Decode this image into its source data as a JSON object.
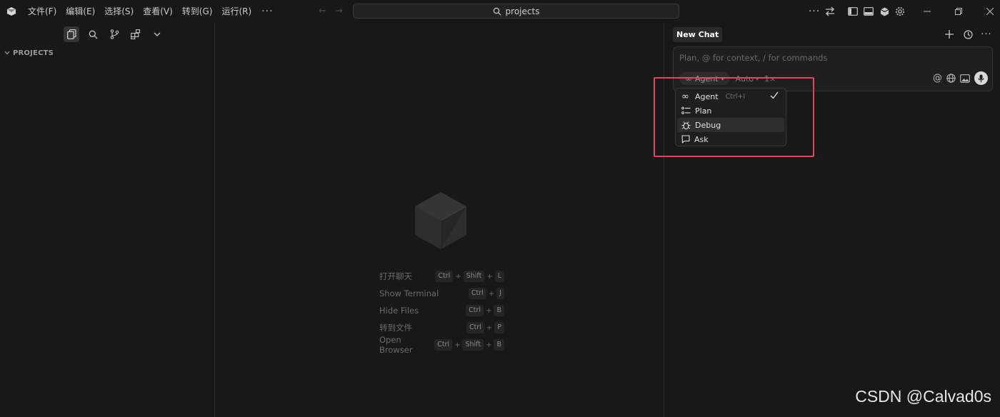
{
  "menu": {
    "items": [
      "文件(F)",
      "编辑(E)",
      "选择(S)",
      "查看(V)",
      "转到(G)",
      "运行(R)"
    ],
    "more": "···"
  },
  "search": {
    "text": "projects"
  },
  "sidebar": {
    "section_title": "PROJECTS"
  },
  "editor": {
    "shortcuts": [
      {
        "label": "打开聊天",
        "keys": [
          "Ctrl",
          "Shift",
          "L"
        ]
      },
      {
        "label": "Show Terminal",
        "keys": [
          "Ctrl",
          "J"
        ]
      },
      {
        "label": "Hide Files",
        "keys": [
          "Ctrl",
          "B"
        ]
      },
      {
        "label": "转到文件",
        "keys": [
          "Ctrl",
          "P"
        ]
      },
      {
        "label": "Open Browser",
        "keys": [
          "Ctrl",
          "Shift",
          "B"
        ]
      }
    ]
  },
  "chat": {
    "tab_title": "New Chat",
    "placeholder": "Plan, @ for context, / for commands",
    "mode": "Agent",
    "model": "Auto",
    "count": "1×"
  },
  "dropdown": {
    "items": [
      {
        "label": "Agent",
        "shortcut": "Ctrl+I",
        "checked": true,
        "icon": "infinity-icon"
      },
      {
        "label": "Plan",
        "shortcut": "",
        "checked": false,
        "icon": "list-icon"
      },
      {
        "label": "Debug",
        "shortcut": "",
        "checked": false,
        "icon": "bug-icon"
      },
      {
        "label": "Ask",
        "shortcut": "",
        "checked": false,
        "icon": "chat-bubble-icon"
      }
    ]
  },
  "watermark": "CSDN @Calvad0s",
  "colors": {
    "background": "#181818",
    "highlight": "#e2465e"
  }
}
